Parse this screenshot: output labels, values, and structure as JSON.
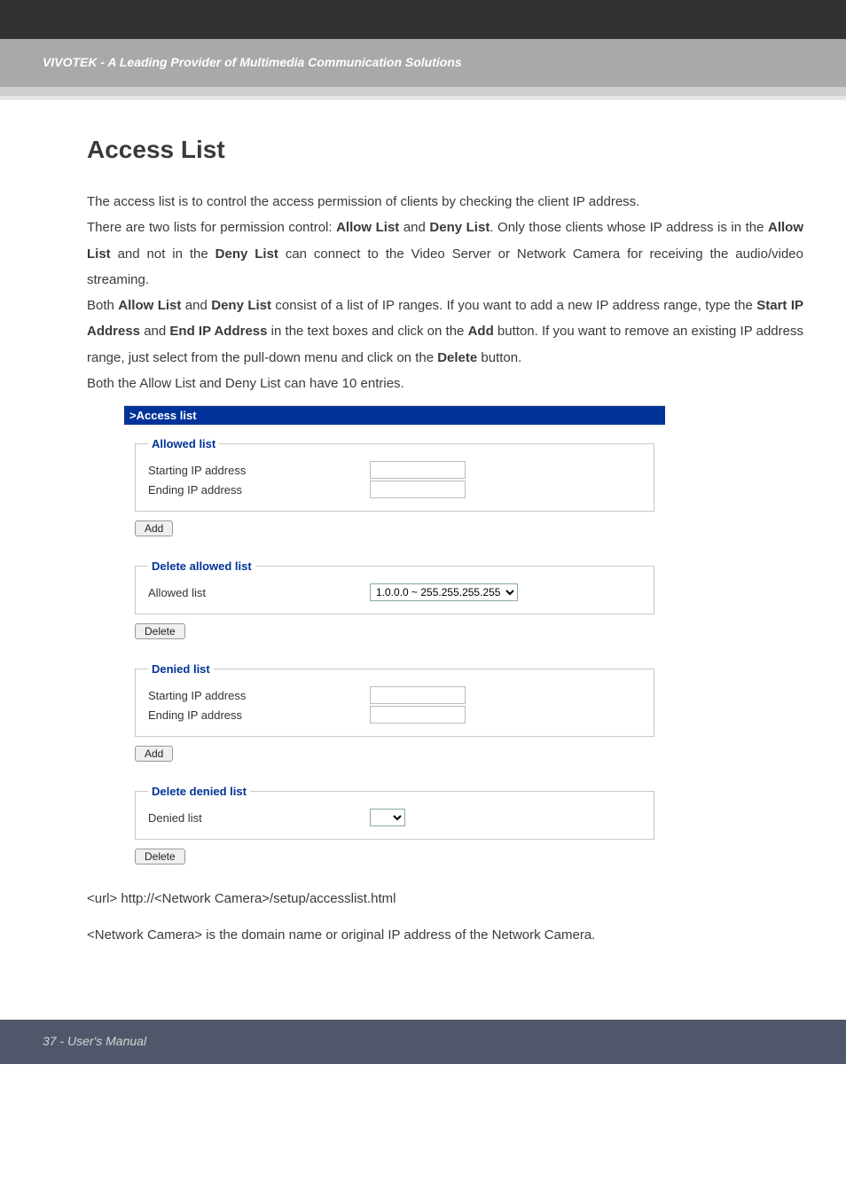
{
  "header": {
    "banner": "VIVOTEK - A Leading Provider of Multimedia Communication Solutions"
  },
  "page": {
    "title": "Access List",
    "para1_pre": "The access list is to control the access permission of clients by checking the client IP address.",
    "para2_a": "There are two lists for permission control: ",
    "para2_b1": "Allow List",
    "para2_c": " and ",
    "para2_b2": "Deny List",
    "para2_d": ". Only those clients whose IP address is in the ",
    "para2_b3": "Allow List",
    "para2_e": " and not in the ",
    "para2_b4": "Deny List",
    "para2_f": " can connect to the Video Server or Network Camera for receiving the audio/video streaming.",
    "para3_a": "Both ",
    "para3_b1": "Allow List",
    "para3_c": " and ",
    "para3_b2": "Deny List",
    "para3_d": " consist of a list of IP ranges. If you want to add a new IP address range, type the ",
    "para3_b3": "Start IP Address",
    "para3_e": " and ",
    "para3_b4": "End IP Address",
    "para3_f": " in the text boxes and click on the ",
    "para3_b5": "Add",
    "para3_g": " button. If you want to remove an existing IP address range, just select from the pull-down menu and click on the ",
    "para3_b6": "Delete",
    "para3_h": " button.",
    "para4": "Both the Allow List and Deny List can have 10 entries."
  },
  "panel": {
    "header": ">Access list",
    "allowed": {
      "legend": "Allowed list",
      "start_label": "Starting IP address",
      "end_label": "Ending IP address",
      "start_value": "",
      "end_value": ""
    },
    "add_label": "Add",
    "delete_allowed": {
      "legend": "Delete allowed list",
      "label": "Allowed list",
      "option": "1.0.0.0 ~ 255.255.255.255"
    },
    "delete_label": "Delete",
    "denied": {
      "legend": "Denied list",
      "start_label": "Starting IP address",
      "end_label": "Ending IP address",
      "start_value": "",
      "end_value": ""
    },
    "delete_denied": {
      "legend": "Delete denied list",
      "label": "Denied list",
      "option": ""
    }
  },
  "url_line1": "<url> http://<Network Camera>/setup/accesslist.html",
  "url_line2": "<Network Camera> is the domain name or original IP address of the Network Camera.",
  "footer": "37 - User's Manual"
}
